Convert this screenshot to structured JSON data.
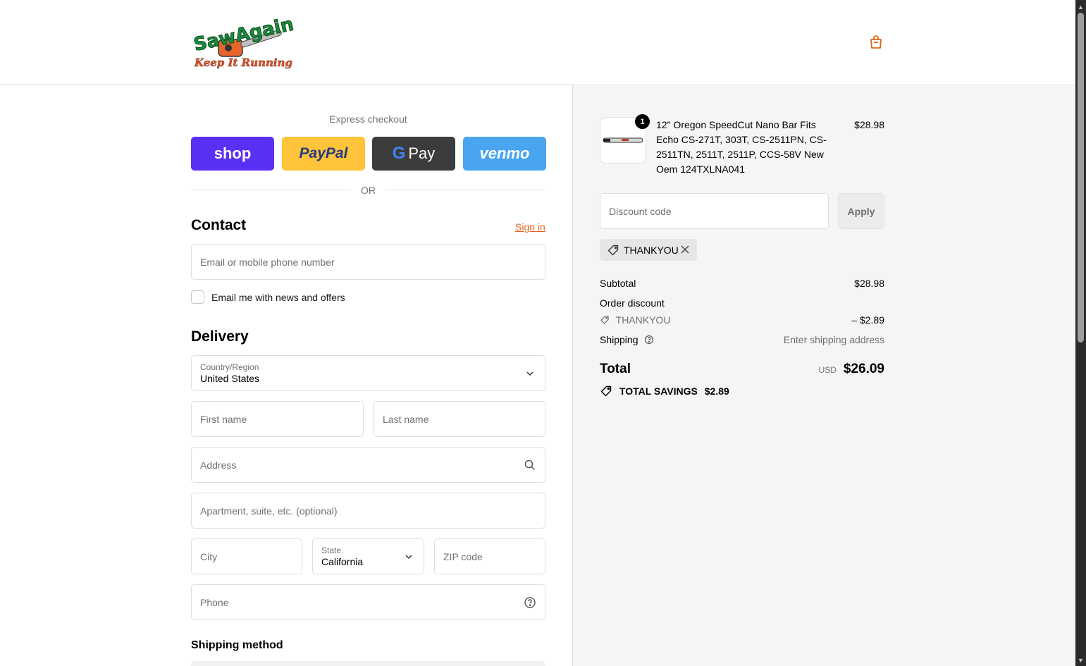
{
  "header": {
    "logo_line1": "SawAgain",
    "logo_line2": "Keep It Running"
  },
  "express": {
    "title": "Express checkout",
    "shop_label": "shop",
    "paypal_label": "PayPal",
    "gpay_label": "Pay",
    "venmo_label": "venmo",
    "or_label": "OR"
  },
  "contact": {
    "title": "Contact",
    "sign_in": "Sign in",
    "email_placeholder": "Email or mobile phone number",
    "news_label": "Email me with news and offers",
    "news_checked": false
  },
  "delivery": {
    "title": "Delivery",
    "country_label": "Country/Region",
    "country_value": "United States",
    "first_name": "First name",
    "last_name": "Last name",
    "address": "Address",
    "apartment": "Apartment, suite, etc. (optional)",
    "city": "City",
    "state_label": "State",
    "state_value": "California",
    "zip": "ZIP code",
    "phone": "Phone"
  },
  "shipping_method": {
    "title": "Shipping method"
  },
  "summary": {
    "product": {
      "quantity": "1",
      "name": "12\" Oregon SpeedCut Nano Bar Fits Echo CS-271T, 303T, CS-2511PN, CS-2511TN, 2511T, 2511P, CCS-58V New Oem 124TXLNA041",
      "price": "$28.98"
    },
    "discount_placeholder": "Discount code",
    "apply_label": "Apply",
    "applied_code": "THANKYOU",
    "subtotal_label": "Subtotal",
    "subtotal_value": "$28.98",
    "order_discount_label": "Order discount",
    "discount_code": "THANKYOU",
    "discount_value": "– $2.89",
    "shipping_label": "Shipping",
    "shipping_value": "Enter shipping address",
    "total_label": "Total",
    "currency": "USD",
    "total_value": "$26.09",
    "savings_label": "TOTAL SAVINGS",
    "savings_value": "$2.89"
  },
  "colors": {
    "accent": "#e4631b",
    "shop": "#5a31f4",
    "paypal": "#ffc439",
    "gpay": "#000000",
    "venmo": "#3d95ce"
  }
}
